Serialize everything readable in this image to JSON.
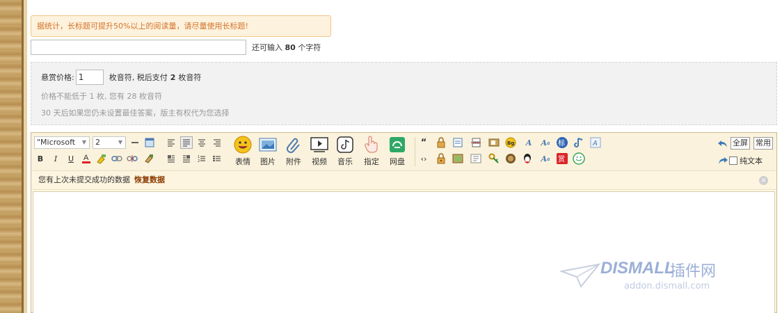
{
  "tip": "据统计，长标题可提升50%以上的阅读量，请尽量使用长标题!",
  "title_field": {
    "value": "",
    "remaining_prefix": "还可输入",
    "remaining_count": "80",
    "remaining_suffix": "个字符"
  },
  "reward": {
    "label": "悬赏价格:",
    "value": "1",
    "after_input": "枚音符, 税后支付",
    "after_tax": "2",
    "unit": "枚音符",
    "line2": "价格不能低于 1 枚, 您有 28 枚音符",
    "line3": "30 天后如果您仍未设置最佳答案，版主有权代为您选择"
  },
  "editor": {
    "font_family": "\"Microsoft",
    "font_size": "2",
    "big_buttons": [
      "表情",
      "图片",
      "附件",
      "视频",
      "音乐",
      "指定",
      "网盘"
    ],
    "fullscreen_label": "全屏",
    "common_label": "常用",
    "plain_text_label": "纯文本",
    "restore_text": "您有上次未提交成功的数据",
    "restore_link": "恢复数据"
  },
  "watermark": {
    "brand": "DISMALL",
    "cn": "插件网",
    "url": "addon.dismall.com"
  },
  "colors": {
    "tip_text": "#d4742a",
    "tip_bg": "#fdf2dd",
    "editor_bg": "#faf2dc",
    "restore_link": "#8a3a00"
  }
}
